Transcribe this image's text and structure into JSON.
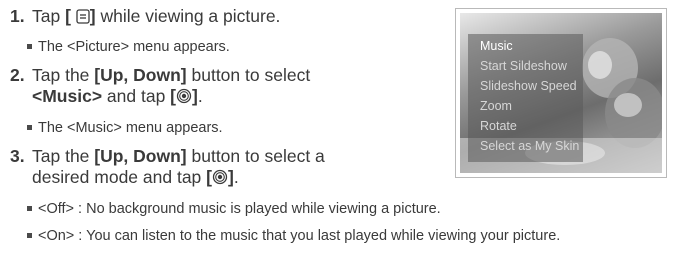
{
  "steps": [
    {
      "num": "1.",
      "pre": "Tap ",
      "icon_label": "[ ",
      "icon_label_end": "]",
      "post": " while viewing a picture."
    },
    {
      "num": "2.",
      "line1_pre": "Tap the ",
      "line1_bold": "[Up, Down]",
      "line1_post": " button to select",
      "line2_bold": "<Music>",
      "line2_mid": " and tap ",
      "line2_icon_open": "[",
      "line2_icon_close": "]",
      "line2_end": "."
    },
    {
      "num": "3.",
      "line1_pre": "Tap the ",
      "line1_bold": "[Up, Down]",
      "line1_post": " button to select a",
      "line2_pre": "desired mode and tap ",
      "line2_icon_open": "[",
      "line2_icon_close": "]",
      "line2_end": "."
    }
  ],
  "bullets": {
    "picture_menu": "The <Picture> menu appears.",
    "music_menu": "The <Music> menu appears.",
    "off": "<Off> : No background music is played while viewing a picture.",
    "on": "<On> : You can listen to the music that you last played while viewing your picture."
  },
  "screen_menu": {
    "items": [
      "Music",
      "Start Sildeshow",
      "Slideshow Speed",
      "Zoom",
      "Rotate",
      "Select as My Skin"
    ],
    "active_index": 0
  },
  "icons": {
    "menu": "menu-icon",
    "select": "select-button-icon"
  }
}
